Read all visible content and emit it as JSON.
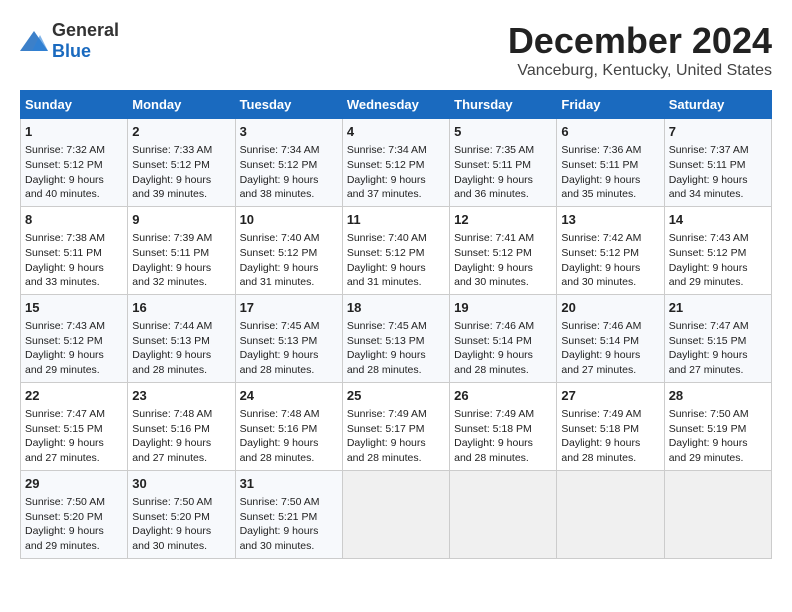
{
  "logo": {
    "general": "General",
    "blue": "Blue"
  },
  "title": "December 2024",
  "location": "Vanceburg, Kentucky, United States",
  "headers": [
    "Sunday",
    "Monday",
    "Tuesday",
    "Wednesday",
    "Thursday",
    "Friday",
    "Saturday"
  ],
  "weeks": [
    [
      {
        "day": "1",
        "sunrise": "Sunrise: 7:32 AM",
        "sunset": "Sunset: 5:12 PM",
        "daylight": "Daylight: 9 hours and 40 minutes."
      },
      {
        "day": "2",
        "sunrise": "Sunrise: 7:33 AM",
        "sunset": "Sunset: 5:12 PM",
        "daylight": "Daylight: 9 hours and 39 minutes."
      },
      {
        "day": "3",
        "sunrise": "Sunrise: 7:34 AM",
        "sunset": "Sunset: 5:12 PM",
        "daylight": "Daylight: 9 hours and 38 minutes."
      },
      {
        "day": "4",
        "sunrise": "Sunrise: 7:34 AM",
        "sunset": "Sunset: 5:12 PM",
        "daylight": "Daylight: 9 hours and 37 minutes."
      },
      {
        "day": "5",
        "sunrise": "Sunrise: 7:35 AM",
        "sunset": "Sunset: 5:11 PM",
        "daylight": "Daylight: 9 hours and 36 minutes."
      },
      {
        "day": "6",
        "sunrise": "Sunrise: 7:36 AM",
        "sunset": "Sunset: 5:11 PM",
        "daylight": "Daylight: 9 hours and 35 minutes."
      },
      {
        "day": "7",
        "sunrise": "Sunrise: 7:37 AM",
        "sunset": "Sunset: 5:11 PM",
        "daylight": "Daylight: 9 hours and 34 minutes."
      }
    ],
    [
      {
        "day": "8",
        "sunrise": "Sunrise: 7:38 AM",
        "sunset": "Sunset: 5:11 PM",
        "daylight": "Daylight: 9 hours and 33 minutes."
      },
      {
        "day": "9",
        "sunrise": "Sunrise: 7:39 AM",
        "sunset": "Sunset: 5:11 PM",
        "daylight": "Daylight: 9 hours and 32 minutes."
      },
      {
        "day": "10",
        "sunrise": "Sunrise: 7:40 AM",
        "sunset": "Sunset: 5:12 PM",
        "daylight": "Daylight: 9 hours and 31 minutes."
      },
      {
        "day": "11",
        "sunrise": "Sunrise: 7:40 AM",
        "sunset": "Sunset: 5:12 PM",
        "daylight": "Daylight: 9 hours and 31 minutes."
      },
      {
        "day": "12",
        "sunrise": "Sunrise: 7:41 AM",
        "sunset": "Sunset: 5:12 PM",
        "daylight": "Daylight: 9 hours and 30 minutes."
      },
      {
        "day": "13",
        "sunrise": "Sunrise: 7:42 AM",
        "sunset": "Sunset: 5:12 PM",
        "daylight": "Daylight: 9 hours and 30 minutes."
      },
      {
        "day": "14",
        "sunrise": "Sunrise: 7:43 AM",
        "sunset": "Sunset: 5:12 PM",
        "daylight": "Daylight: 9 hours and 29 minutes."
      }
    ],
    [
      {
        "day": "15",
        "sunrise": "Sunrise: 7:43 AM",
        "sunset": "Sunset: 5:12 PM",
        "daylight": "Daylight: 9 hours and 29 minutes."
      },
      {
        "day": "16",
        "sunrise": "Sunrise: 7:44 AM",
        "sunset": "Sunset: 5:13 PM",
        "daylight": "Daylight: 9 hours and 28 minutes."
      },
      {
        "day": "17",
        "sunrise": "Sunrise: 7:45 AM",
        "sunset": "Sunset: 5:13 PM",
        "daylight": "Daylight: 9 hours and 28 minutes."
      },
      {
        "day": "18",
        "sunrise": "Sunrise: 7:45 AM",
        "sunset": "Sunset: 5:13 PM",
        "daylight": "Daylight: 9 hours and 28 minutes."
      },
      {
        "day": "19",
        "sunrise": "Sunrise: 7:46 AM",
        "sunset": "Sunset: 5:14 PM",
        "daylight": "Daylight: 9 hours and 28 minutes."
      },
      {
        "day": "20",
        "sunrise": "Sunrise: 7:46 AM",
        "sunset": "Sunset: 5:14 PM",
        "daylight": "Daylight: 9 hours and 27 minutes."
      },
      {
        "day": "21",
        "sunrise": "Sunrise: 7:47 AM",
        "sunset": "Sunset: 5:15 PM",
        "daylight": "Daylight: 9 hours and 27 minutes."
      }
    ],
    [
      {
        "day": "22",
        "sunrise": "Sunrise: 7:47 AM",
        "sunset": "Sunset: 5:15 PM",
        "daylight": "Daylight: 9 hours and 27 minutes."
      },
      {
        "day": "23",
        "sunrise": "Sunrise: 7:48 AM",
        "sunset": "Sunset: 5:16 PM",
        "daylight": "Daylight: 9 hours and 27 minutes."
      },
      {
        "day": "24",
        "sunrise": "Sunrise: 7:48 AM",
        "sunset": "Sunset: 5:16 PM",
        "daylight": "Daylight: 9 hours and 28 minutes."
      },
      {
        "day": "25",
        "sunrise": "Sunrise: 7:49 AM",
        "sunset": "Sunset: 5:17 PM",
        "daylight": "Daylight: 9 hours and 28 minutes."
      },
      {
        "day": "26",
        "sunrise": "Sunrise: 7:49 AM",
        "sunset": "Sunset: 5:18 PM",
        "daylight": "Daylight: 9 hours and 28 minutes."
      },
      {
        "day": "27",
        "sunrise": "Sunrise: 7:49 AM",
        "sunset": "Sunset: 5:18 PM",
        "daylight": "Daylight: 9 hours and 28 minutes."
      },
      {
        "day": "28",
        "sunrise": "Sunrise: 7:50 AM",
        "sunset": "Sunset: 5:19 PM",
        "daylight": "Daylight: 9 hours and 29 minutes."
      }
    ],
    [
      {
        "day": "29",
        "sunrise": "Sunrise: 7:50 AM",
        "sunset": "Sunset: 5:20 PM",
        "daylight": "Daylight: 9 hours and 29 minutes."
      },
      {
        "day": "30",
        "sunrise": "Sunrise: 7:50 AM",
        "sunset": "Sunset: 5:20 PM",
        "daylight": "Daylight: 9 hours and 30 minutes."
      },
      {
        "day": "31",
        "sunrise": "Sunrise: 7:50 AM",
        "sunset": "Sunset: 5:21 PM",
        "daylight": "Daylight: 9 hours and 30 minutes."
      },
      null,
      null,
      null,
      null
    ]
  ]
}
